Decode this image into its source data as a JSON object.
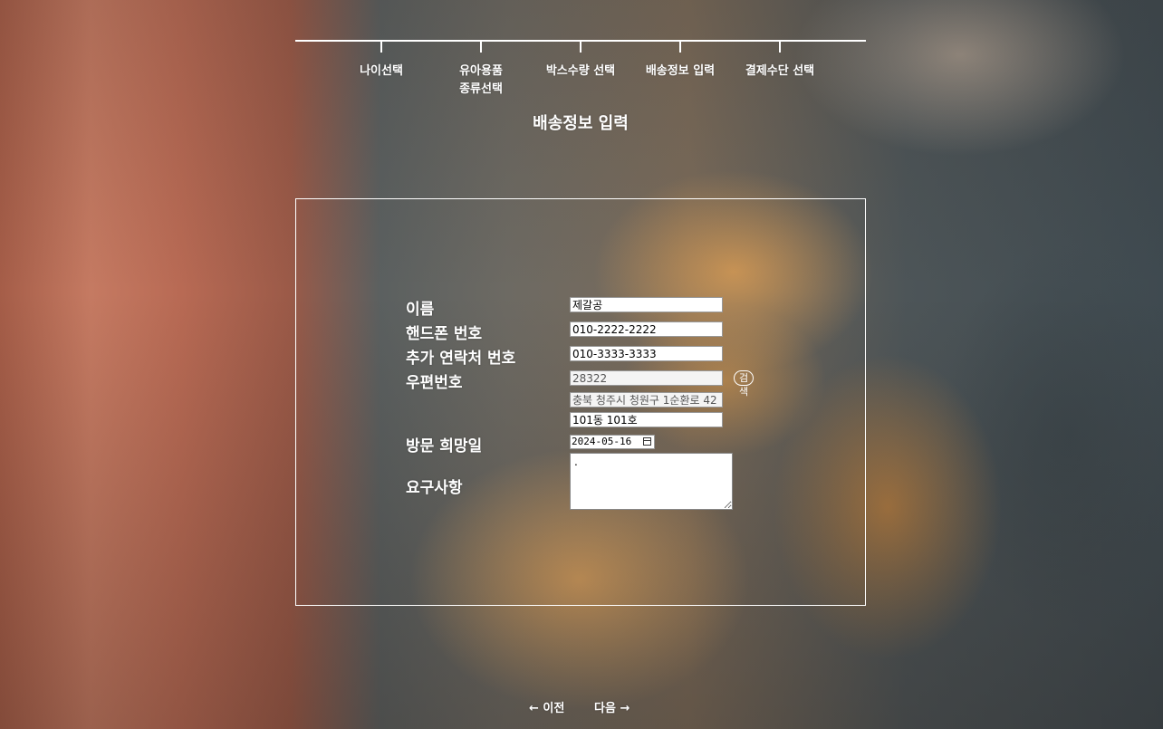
{
  "steps": [
    {
      "label": "나이선택"
    },
    {
      "label": "유아용품\n종류선택"
    },
    {
      "label": "박스수량 선택"
    },
    {
      "label": "배송정보 입력"
    },
    {
      "label": "결제수단 선택"
    }
  ],
  "page_title": "배송정보 입력",
  "form": {
    "name_label": "이름",
    "name_value": "제갈공",
    "phone_label": "핸드폰 번호",
    "phone_value": "010-2222-2222",
    "extra_phone_label": "추가 연락처 번호",
    "extra_phone_value": "010-3333-3333",
    "postcode_label": "우편번호",
    "postcode_value": "28322",
    "search_label": "검색",
    "address_value": "충북 청주시 청원구 1순환로 42",
    "address_detail_value": "101동 101호",
    "visit_date_label": "방문 희망일",
    "visit_date_value": "2024-05-16",
    "request_label": "요구사항",
    "request_value": "."
  },
  "nav": {
    "prev_label": "← 이전",
    "next_label": "다음 →"
  },
  "colors": {
    "text": "#ffffff",
    "border": "#ffffff"
  }
}
